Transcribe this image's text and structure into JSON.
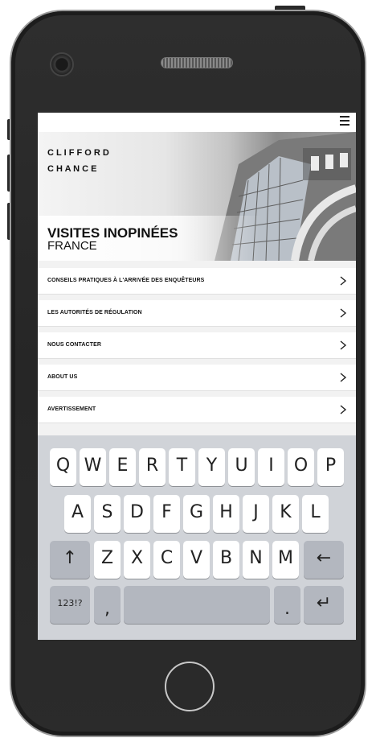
{
  "header": {
    "menu_icon": "hamburger-menu-icon"
  },
  "banner": {
    "logo_line1": "C L I F F O R D",
    "logo_line2": "C H A N C E",
    "title": "VISITES INOPINÉES",
    "subtitle": "FRANCE"
  },
  "menu": {
    "items": [
      {
        "label": "CONSEILS PRATIQUES À L'ARRIVÉE DES ENQUÊTEURS",
        "icon": "chevron-right-icon"
      },
      {
        "label": "LES AUTORITÉS DE RÉGULATION",
        "icon": "chevron-right-icon"
      },
      {
        "label": "NOUS CONTACTER",
        "icon": "chevron-right-icon"
      },
      {
        "label": "ABOUT US",
        "icon": "chevron-right-icon"
      },
      {
        "label": "AVERTISSEMENT",
        "icon": "chevron-right-icon"
      }
    ]
  },
  "keyboard": {
    "row1": [
      "Q",
      "W",
      "E",
      "R",
      "T",
      "Y",
      "U",
      "I",
      "O",
      "P"
    ],
    "row2": [
      "A",
      "S",
      "D",
      "F",
      "G",
      "H",
      "J",
      "K",
      "L"
    ],
    "row3": [
      "Z",
      "X",
      "C",
      "V",
      "B",
      "N",
      "M"
    ],
    "shift": "↑",
    "backspace": "←",
    "numbers": "123!?",
    "comma": ",",
    "period": ".",
    "enter": "↵"
  }
}
